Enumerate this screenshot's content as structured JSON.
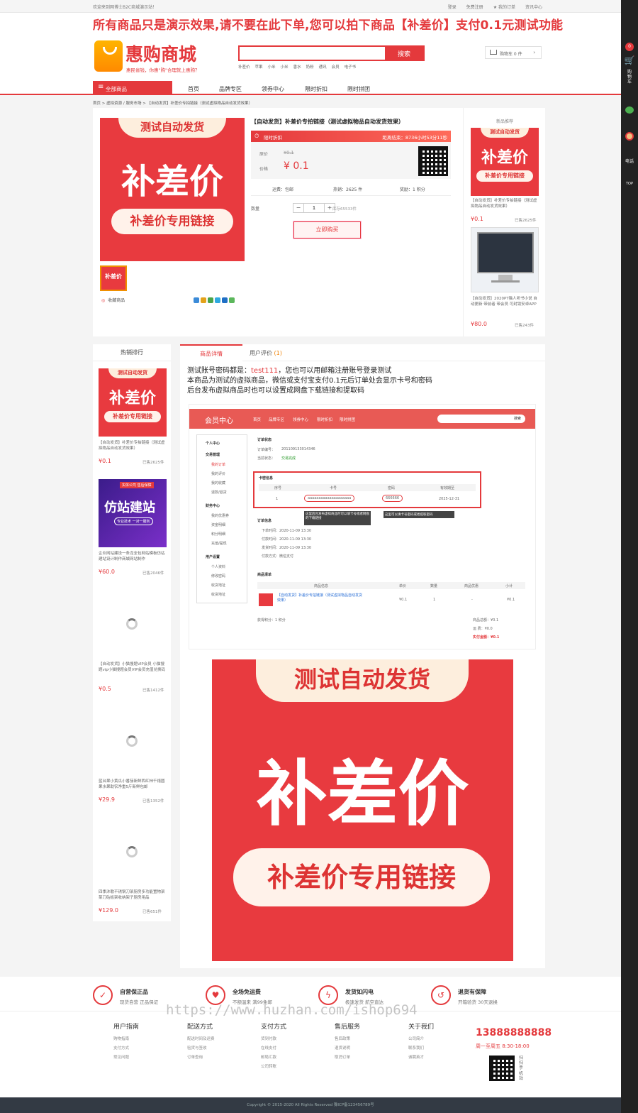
{
  "topbar": {
    "welcome": "欢迎来到网博士B2C商城演示站！",
    "links": [
      "登录",
      "免费注册",
      "★ 我的订单",
      "资讯中心"
    ]
  },
  "notice": "所有商品只是演示效果,请不要在此下单,您可以拍下商品【补差价】支付0.1元测试功能",
  "header": {
    "logo_name": "惠购商城",
    "logo_slogan": "惠民省钱，你惠\"购\"合理就上惠购？",
    "search_placeholder": "",
    "search_button": "搜索",
    "hotwords": [
      "补差价",
      "苹果",
      "小米",
      "小米",
      "香水",
      "奶粉",
      "通讯",
      "会员",
      "电子书"
    ],
    "cart_label": "购物车 0 件",
    "cart_chevron": "›"
  },
  "nav": {
    "all_categories": "全部商品",
    "items": [
      "首页",
      "品牌专区",
      "领券中心",
      "限时折扣",
      "限时拼团"
    ]
  },
  "breadcrumb": "首页 > 虚拟资源 / 服务市场 > 【自动发货】补差价专拍链接（测试虚拟物品自动发货效果）",
  "banner_text": {
    "tag": "测试自动发货",
    "big": "补差价",
    "pill": "补差价专用链接"
  },
  "product": {
    "thumb_text": "补差价",
    "favorite": "收藏商品",
    "title": "【自动发货】补差价专拍链接（测试虚拟物品自动发货效果）",
    "flash_label": "限时折扣",
    "flash_countdown": "距离结束：8736小时53分11秒",
    "orig_label": "原价",
    "orig_price": "¥0.1",
    "price_label": "价格",
    "price": "¥ 0.1",
    "freight": "运费：包邮",
    "sold": "热销：2625 件",
    "points": "奖励：1 积分",
    "qty_label": "数量",
    "qty_minus": "−",
    "qty_value": "1",
    "qty_plus": "+",
    "stock": "库存65533件",
    "buy_button": "立即购买"
  },
  "recommend": {
    "head": "新品推荐",
    "items": [
      {
        "title": "【自动发货】补差价专拍链接（测试虚拟物品自动发货效果）",
        "price": "¥0.1",
        "sold": "已售2625件"
      },
      {
        "title": "【自动发货】2020PT猫人听书小说 自动更新 带前者 带会员 可封锁安卓APP",
        "price": "¥80.0",
        "sold": "已售243件"
      }
    ]
  },
  "sidebar": {
    "head": "热销排行",
    "items": [
      {
        "title": "【自动发货】补差价专拍链接（测试虚拟物品自动发货效果）",
        "price": "¥0.1",
        "sold": "已售2625件"
      },
      {
        "title": "企业网站建设一条龙全包网站模板仿站建站设计制作商城网站制作",
        "price": "¥60.0",
        "sold": "已售2046件"
      },
      {
        "title": "【自动发货】小猫搜题VIP会员 小猫搜题vip小猫搜题会员VIP会员充值兑换码",
        "price": "¥0.5",
        "sold": "已售1412件"
      },
      {
        "title": "蓝台果小黄瓜小番茄新鲜西红柿千禧圆果水果助农净重5斤新鲜包邮",
        "price": "¥29.9",
        "sold": "已售1352件"
      },
      {
        "title": "四季沐歌不锈钢刀架厨房多功能置物架菜刀砧板架收纳架子厨房用品",
        "price": "¥129.0",
        "sold": "已售651件"
      }
    ],
    "site_banner": {
      "badge": "实体公司 售后保障",
      "title": "仿站建站",
      "sub": "专业技术 一对一服务"
    }
  },
  "detail": {
    "tabs": [
      "商品详情",
      "用户评价"
    ],
    "review_count": "(1)",
    "desc_prefix": "测试账号密码都是：",
    "desc_account": "test111",
    "desc_suffix": "，您也可以用邮箱注册账号登录测试",
    "desc_lines": [
      "本商品为测试的虚拟商品，微信或支付宝支付0.1元后订单处会显示卡号和密码",
      "后台发布虚拟商品时也可以设置成网盘下载链接和提取码"
    ],
    "shot": {
      "member_center": "会员中心",
      "menu": [
        "首页",
        "品牌专区",
        "领券中心",
        "限时折扣",
        "限时拼团"
      ],
      "search_btn": "搜索",
      "left_menu": [
        "个人中心",
        "交易管理",
        "我的订单",
        "我的评价",
        "我的收藏",
        "退款/退货",
        "财务中心",
        "我的优惠券",
        "资金明细",
        "积分明细",
        "充值/提现",
        "用户设置",
        "个人资料",
        "修改密码",
        "收货地址",
        "收货地址"
      ],
      "order_status": "订单状态",
      "order_no_label": "订单编号：",
      "order_no": "201109133014346",
      "order_state_label": "当前状态：",
      "order_state": "交易完成",
      "card_info": "卡密信息",
      "card_headers": [
        "序号",
        "卡号",
        "密码",
        "有效期至"
      ],
      "card_row": [
        "1",
        "aaaaaaaaaaaaaaaaaaaa",
        "666666",
        "2025-12-31"
      ],
      "tip1": "这里后台发布虚拟商品时可以填卡号或者网盘的下载链接",
      "tip2": "这里可以填卡号密码或者提取密码",
      "order_info": "订单信息",
      "order_times": [
        "下单时间：2020-11-09 13:30",
        "付款时间：2020-11-09 13:30",
        "发货时间：2020-11-09 13:30",
        "付款方式：微信支付"
      ],
      "goods_list": "商品清单",
      "goods_headers": [
        "商品信息",
        "单价",
        "数量",
        "商品优惠",
        "小计"
      ],
      "goods_row": [
        "【自动发货】补差价专拍链接（测试虚拟物品自动发货效果）",
        "¥0.1",
        "1",
        "-",
        "¥0.1"
      ],
      "get_points": "获得积分：1 积分",
      "totals": [
        "商品总额：¥0.1",
        "运 费：¥0.0",
        "实付金额：¥0.1"
      ]
    }
  },
  "features": [
    {
      "title": "自营保正品",
      "sub": "现货自营 正品保证",
      "icon": "shield-icon"
    },
    {
      "title": "全场免运费",
      "sub": "不额温来 满99免邮",
      "icon": "gift-icon"
    },
    {
      "title": "发货如闪电",
      "sub": "极速发货 航空直达",
      "icon": "lightning-icon"
    },
    {
      "title": "退货有保障",
      "sub": "开箱验货 30天退换",
      "icon": "return-icon"
    }
  ],
  "footer": {
    "columns": [
      {
        "head": "用户指南",
        "links": [
          "购物指南",
          "支付方式",
          "常见问题"
        ]
      },
      {
        "head": "配送方式",
        "links": [
          "配送时间及运费",
          "验货与签收",
          "订单查询"
        ]
      },
      {
        "head": "支付方式",
        "links": [
          "货到付款",
          "在线支付",
          "邮局汇款",
          "公司转账"
        ]
      },
      {
        "head": "售后服务",
        "links": [
          "售后政策",
          "退货说明",
          "取消订单"
        ]
      },
      {
        "head": "关于我们",
        "links": [
          "公司简介",
          "联系我们",
          "诚聘英才"
        ]
      }
    ],
    "hotline": "13888888888",
    "hours": "周一至周五 8:30-18:00",
    "scan": "扫扫手机站",
    "copyright": "Copyright © 2015-2020 All Rights Reserved 豫ICP备123456789号"
  },
  "watermark": "https://www.huzhan.com/ishop694",
  "rightbar": {
    "badge": "0",
    "cart": "购物车",
    "phone": "电话",
    "top": "TOP"
  },
  "colors": {
    "accent": "#e4393c",
    "banner": "#e83a3f",
    "orange": "#ffb400"
  }
}
